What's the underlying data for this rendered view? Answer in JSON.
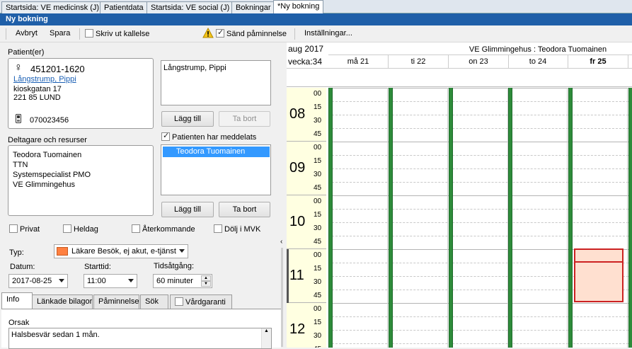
{
  "tabs": [
    {
      "label": "Startsida: VE medicinsk (J)"
    },
    {
      "label": "Patientdata"
    },
    {
      "label": "Startsida: VE social (J)"
    },
    {
      "label": "Bokningar"
    },
    {
      "label": "*Ny bokning"
    }
  ],
  "window_title": "Ny bokning",
  "toolbar": {
    "cancel_label": "Avbryt",
    "save_label": "Spara",
    "print_label": "Skriv ut kallelse",
    "reminder_label": "Sänd påminnelse",
    "settings_label": "Inställningar..."
  },
  "patient": {
    "section_label": "Patient(er)",
    "id": "451201-1620",
    "name": "Långstrump, Pippi",
    "street": "kioskgatan 17",
    "city": "221 85 LUND",
    "phone": "070023456",
    "list": [
      "Långstrump, Pippi"
    ],
    "add_label": "Lägg till",
    "remove_label": "Ta bort"
  },
  "participants": {
    "section_label": "Deltagare och resurser",
    "items": [
      "Teodora Tuomainen",
      "TTN",
      "Systemspecialist PMO",
      "VE Glimmingehus"
    ],
    "patient_informed_label": "Patienten har meddelats",
    "selected_list": [
      "Teodora Tuomainen"
    ],
    "add_label": "Lägg till",
    "remove_label": "Ta bort"
  },
  "options": {
    "private": "Privat",
    "full_day": "Heldag",
    "recurring": "Återkommande",
    "hide_mvk": "Dölj i MVK"
  },
  "booking": {
    "type_label": "Typ:",
    "type_value": "Läkare Besök, ej akut, e-tjänst",
    "type_color": "#ff8040",
    "date_label": "Datum:",
    "date_value": "2017-08-25",
    "start_label": "Starttid:",
    "start_value": "11:00",
    "duration_label": "Tidsåtgång:",
    "duration_value": "60 minuter"
  },
  "bottom_tabs": {
    "info": "Info",
    "attachments": "Länkade bilagor",
    "reminder": "Påminnelse",
    "search": "Sök",
    "guarantee": "Vårdgaranti"
  },
  "reason": {
    "label": "Orsak",
    "text": "Halsbesvär sedan 1 mån."
  },
  "calendar": {
    "month": "aug 2017",
    "week": "vecka:34",
    "resource": "VE Glimmingehus : Teodora Tuomainen",
    "days": [
      "må 21",
      "ti 22",
      "on 23",
      "to 24",
      "fr 25"
    ],
    "hours": [
      "08",
      "09",
      "10",
      "11",
      "12"
    ],
    "minutes": [
      "00",
      "15",
      "30",
      "45"
    ],
    "accent_color": "#2e8b3a",
    "selection_color": "#ffe0d0",
    "selection_border": "#cc2222"
  }
}
